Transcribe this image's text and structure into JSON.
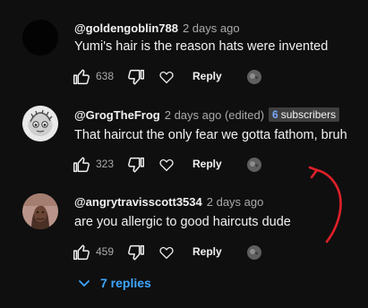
{
  "comments": [
    {
      "handle": "@goldengoblin788",
      "time": "2 days ago",
      "text": "Yumi's hair is the reason hats were invented",
      "likes": "638",
      "reply_label": "Reply"
    },
    {
      "handle": "@GrogTheFrog",
      "time": "2 days ago (edited)",
      "badge_number": "6",
      "badge_text": "subscribers",
      "text": "That haircut the only fear we gotta fathom, bruh",
      "likes": "323",
      "reply_label": "Reply"
    },
    {
      "handle": "@angrytravisscott3534",
      "time": "2 days ago",
      "text": "are you allergic to good haircuts dude",
      "likes": "459",
      "reply_label": "Reply"
    }
  ],
  "replies_toggle": {
    "label": "7 replies"
  },
  "colors": {
    "background": "#0f0f0f",
    "link_blue": "#3ea6ff",
    "annotation_red": "#e0202a"
  },
  "icons": [
    "thumb-up-icon",
    "thumb-down-icon",
    "heart-icon",
    "creator-heart-icon",
    "chevron-down-icon",
    "red-arrow-annotation"
  ]
}
